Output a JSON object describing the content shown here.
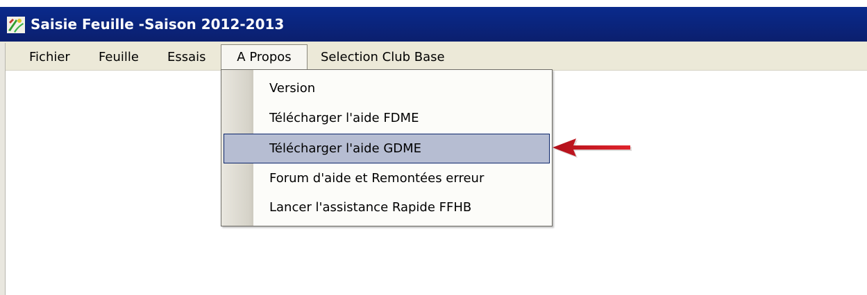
{
  "window": {
    "title": "Saisie Feuille -Saison 2012-2013",
    "icon": "app-logo-icon"
  },
  "menubar": {
    "items": [
      {
        "label": "Fichier"
      },
      {
        "label": "Feuille"
      },
      {
        "label": "Essais"
      },
      {
        "label": "A Propos",
        "open": true
      },
      {
        "label": "Selection Club Base"
      }
    ]
  },
  "dropdown": {
    "items": [
      {
        "label": "Version"
      },
      {
        "label": "Télécharger l'aide FDME"
      },
      {
        "label": "Télécharger l'aide GDME",
        "highlighted": true
      },
      {
        "label": "Forum d'aide et Remontées erreur"
      },
      {
        "label": "Lancer l'assistance Rapide FFHB"
      }
    ]
  },
  "annotation": {
    "icon": "red-arrow-icon",
    "color": "#c8161d"
  },
  "colors": {
    "titlebar": "#0b1f6e",
    "menubar": "#ece9d8",
    "highlight": "#b6bdd2",
    "highlight_border": "#0a246a"
  }
}
